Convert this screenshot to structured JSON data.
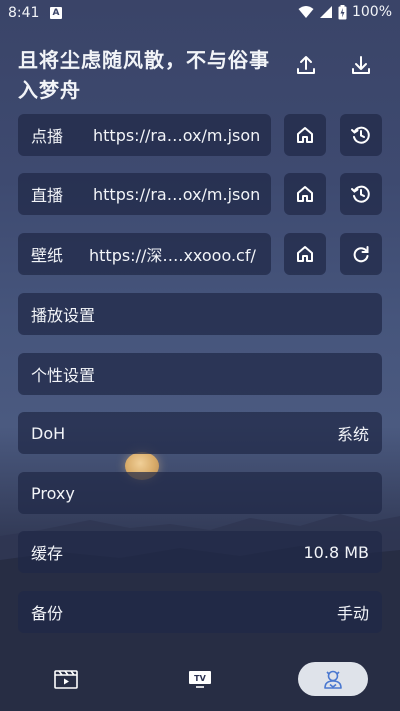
{
  "status_bar": {
    "time": "8:41",
    "notification_icon": "A",
    "battery": "100%"
  },
  "header": {
    "title": "且将尘虑随风散，不与俗事入梦舟"
  },
  "rows": [
    {
      "label": "点播",
      "value": "https://ra…ox/m.json",
      "action_icon": "history-icon"
    },
    {
      "label": "直播",
      "value": "https://ra…ox/m.json",
      "action_icon": "history-icon"
    },
    {
      "label": "壁纸",
      "value": "https://深….xxooo.cf/",
      "action_icon": "refresh-icon"
    }
  ],
  "settings": [
    {
      "label": "播放设置",
      "value": ""
    },
    {
      "label": "个性设置",
      "value": ""
    },
    {
      "label": "DoH",
      "value": "系统"
    },
    {
      "label": "Proxy",
      "value": ""
    },
    {
      "label": "缓存",
      "value": "10.8 MB"
    },
    {
      "label": "备份",
      "value": "手动"
    }
  ],
  "nav": {
    "tv_label": "TV",
    "items": [
      "vod-nav-icon",
      "live-tv-nav-icon",
      "settings-nav-icon"
    ],
    "active_index": 2
  }
}
